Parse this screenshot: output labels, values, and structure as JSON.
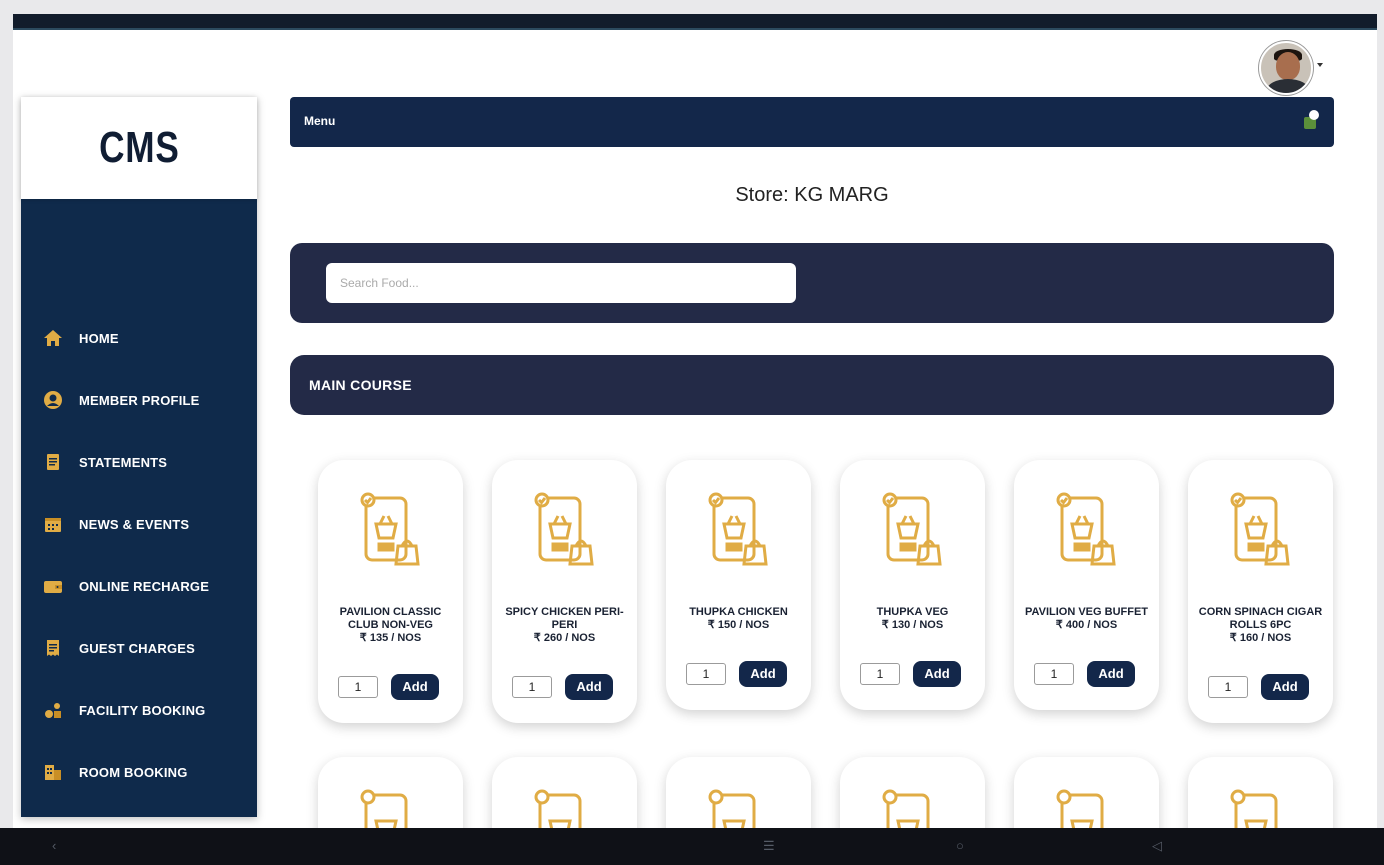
{
  "header": {
    "avatar": "user-avatar"
  },
  "sidebar": {
    "logo": "CMS",
    "items": [
      {
        "label": "HOME",
        "icon": "home-icon"
      },
      {
        "label": "MEMBER PROFILE",
        "icon": "user-circle-icon"
      },
      {
        "label": "STATEMENTS",
        "icon": "document-icon"
      },
      {
        "label": "NEWS & EVENTS",
        "icon": "calendar-icon"
      },
      {
        "label": "ONLINE RECHARGE",
        "icon": "wallet-icon"
      },
      {
        "label": "GUEST CHARGES",
        "icon": "receipt-icon"
      },
      {
        "label": "FACILITY BOOKING",
        "icon": "facility-icon"
      },
      {
        "label": "ROOM BOOKING",
        "icon": "room-icon"
      }
    ]
  },
  "menu_bar": {
    "title": "Menu"
  },
  "store": {
    "label": "Store: KG MARG"
  },
  "search": {
    "placeholder": "Search Food...",
    "value": ""
  },
  "category": {
    "title": "MAIN COURSE"
  },
  "products": [
    {
      "name_lines": [
        "PAVILION CLASSIC",
        "CLUB NON-VEG"
      ],
      "price": "₹ 135 / NOS",
      "qty": "1",
      "add_label": "Add"
    },
    {
      "name_lines": [
        "SPICY CHICKEN PERI-",
        "PERI"
      ],
      "price": "₹ 260 / NOS",
      "qty": "1",
      "add_label": "Add"
    },
    {
      "name_lines": [
        "THUPKA CHICKEN"
      ],
      "price": "₹ 150 / NOS",
      "qty": "1",
      "add_label": "Add"
    },
    {
      "name_lines": [
        "THUPKA VEG"
      ],
      "price": "₹ 130 / NOS",
      "qty": "1",
      "add_label": "Add"
    },
    {
      "name_lines": [
        "PAVILION VEG BUFFET"
      ],
      "price": "₹ 400 / NOS",
      "qty": "1",
      "add_label": "Add"
    },
    {
      "name_lines": [
        "CORN SPINACH CIGAR",
        "ROLLS 6PC"
      ],
      "price": "₹ 160 / NOS",
      "qty": "1",
      "add_label": "Add"
    }
  ],
  "colors": {
    "navy": "#13274a",
    "sidebar": "#0f2a4b",
    "bar": "#232a47",
    "gold": "#e0ac45"
  }
}
